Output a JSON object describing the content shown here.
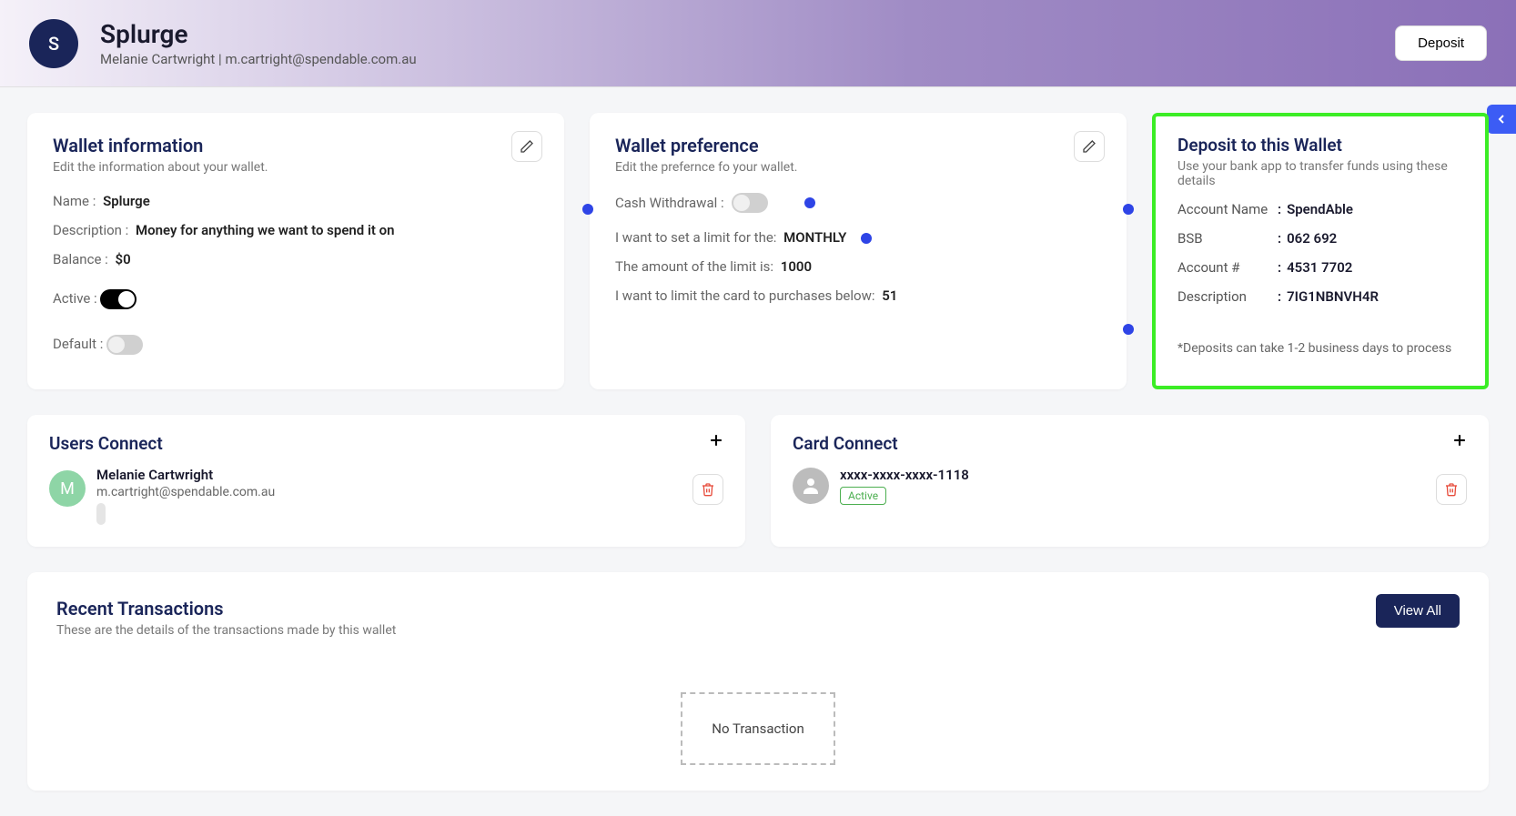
{
  "header": {
    "avatar_letter": "S",
    "title": "Splurge",
    "subtitle": "Melanie Cartwright | m.cartright@spendable.com.au",
    "deposit_button": "Deposit"
  },
  "wallet_info": {
    "title": "Wallet information",
    "subtitle": "Edit the information about your wallet.",
    "name_label": "Name :",
    "name_value": "Splurge",
    "desc_label": "Description :",
    "desc_value": "Money for anything we want to spend it on",
    "balance_label": "Balance :",
    "balance_value": "$0",
    "active_label": "Active :",
    "default_label": "Default :"
  },
  "wallet_pref": {
    "title": "Wallet preference",
    "subtitle": "Edit the prefernce fo your wallet.",
    "cash_withdrawal_label": "Cash Withdrawal :",
    "limit_label": "I want to set a limit for the:",
    "limit_value": "MONTHLY",
    "amount_label": "The amount of the limit is:",
    "amount_value": "1000",
    "purchase_label": "I want to limit the card to purchases below:",
    "purchase_value": "51"
  },
  "deposit_panel": {
    "title": "Deposit to this Wallet",
    "subtitle": "Use your bank app to transfer funds using these details",
    "account_name_label": "Account Name",
    "account_name_value": "SpendAble",
    "bsb_label": "BSB",
    "bsb_value": "062 692",
    "account_num_label": "Account #",
    "account_num_value": "4531 7702",
    "desc_label": "Description",
    "desc_value": "7IG1NBNVH4R",
    "note": "*Deposits can take 1-2 business days to process"
  },
  "users_connect": {
    "title": "Users Connect",
    "user_name": "Melanie Cartwright",
    "user_email": "m.cartright@spendable.com.au",
    "avatar_letter": "M"
  },
  "card_connect": {
    "title": "Card Connect",
    "card_number": "xxxx-xxxx-xxxx-1118",
    "status": "Active"
  },
  "transactions": {
    "title": "Recent Transactions",
    "subtitle": "These are the details of the transactions made by this wallet",
    "view_all": "View All",
    "empty": "No Transaction"
  }
}
